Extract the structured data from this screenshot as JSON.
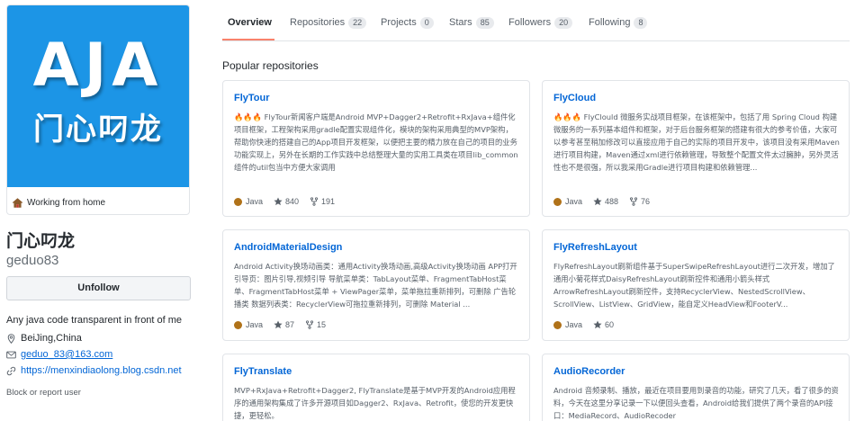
{
  "profile": {
    "avatar_line1": "AJA",
    "avatar_line2": "门心叼龙",
    "status": "Working from home",
    "display_name": "门心叼龙",
    "login": "geduo83",
    "follow_label": "Unfollow",
    "bio": "Any java code transparent in front of me",
    "location": "BeiJing,China",
    "email": "geduo_83@163.com",
    "website": "https://menxindiaolong.blog.csdn.net",
    "block_label": "Block or report user"
  },
  "tabs": [
    {
      "label": "Overview",
      "count": null
    },
    {
      "label": "Repositories",
      "count": "22"
    },
    {
      "label": "Projects",
      "count": "0"
    },
    {
      "label": "Stars",
      "count": "85"
    },
    {
      "label": "Followers",
      "count": "20"
    },
    {
      "label": "Following",
      "count": "8"
    }
  ],
  "section_title": "Popular repositories",
  "repos": [
    {
      "name": "FlyTour",
      "description": "🔥🔥🔥 FlyTour新闻客户端是Android MVP+Dagger2+Retrofit+RxJava+组件化项目框架，工程架构采用gradle配置实现组件化，模块的架构采用典型的MVP架构，帮助你快速的搭建自己的App项目开发框架，以便把主要的精力放在自己的项目的业务功能实现上，另外在长期的工作实践中总结整理大量的实用工具类在项目lib_common组件的util包当中方便大家调用",
      "language": "Java",
      "stars": "840",
      "forks": "191"
    },
    {
      "name": "FlyCloud",
      "description": "🔥🔥🔥 FlyClould 微服务实战项目框架，在该框架中，包括了用 Spring Cloud 构建微服务的一系列基本组件和框架，对于后台服务框架的搭建有很大的参考价值，大家可以参考甚至稍加修改可以直接应用于自己的实际的项目开发中，该项目没有采用Maven进行项目构建，Maven通过xml进行依赖管理，导致整个配置文件太过臃肿，另外灵活性也不是很强，所以我采用Gradle进行项目构建和依赖管理...",
      "language": "Java",
      "stars": "488",
      "forks": "76"
    },
    {
      "name": "AndroidMaterialDesign",
      "description": "Android Activity换场动画类：通用Activity换场动画,高级Activity换场动画 APP打开引导页：图片引导,视频引导 导航菜单类：TabLayout菜单、FragmentTabHost菜单、FragmentTabHost菜单 + ViewPager菜单，菜单拖拉重新排列，可删除 广告轮播类 数据列表类：RecyclerView可拖拉重新排列，可删除 Material ...",
      "language": "Java",
      "stars": "87",
      "forks": "15"
    },
    {
      "name": "FlyRefreshLayout",
      "description": "FlyRefreshLayout刷新组件基于SuperSwipeRefreshLayout进行二次开发，增加了通用小菊花样式DaisyRefreshLayout刷新控件和通用小箭头样式ArrowRefreshLayout刷新控件，支持RecyclerView、NestedScrollView、ScrollView、ListView、GridView，能自定义HeadView和FooterV...",
      "language": "Java",
      "stars": "60",
      "forks": null
    },
    {
      "name": "FlyTranslate",
      "description": "MVP+RxJava+Retrofit+Dagger2, FlyTranslate是基于MVP开发的Android应用程序的通用架构集成了许多开源项目如Dagger2、RxJava、Retrofit，使您的开发更快捷，更轻松。",
      "language": null,
      "stars": null,
      "forks": null
    },
    {
      "name": "AudioRecorder",
      "description": "Android 音频录制、播放，最近在项目要用到录音的功能，研究了几天，看了很多的资料，今天在这里分享记录一下以便回头查看，Android给我们提供了两个录音的API接口：MediaRecord、AudioRecoder",
      "language": null,
      "stars": null,
      "forks": null
    }
  ],
  "colors": {
    "java": "#b07219",
    "link": "#0366d6",
    "avatar_bg": "#1c95e6",
    "tab_underline": "#f9826c"
  }
}
